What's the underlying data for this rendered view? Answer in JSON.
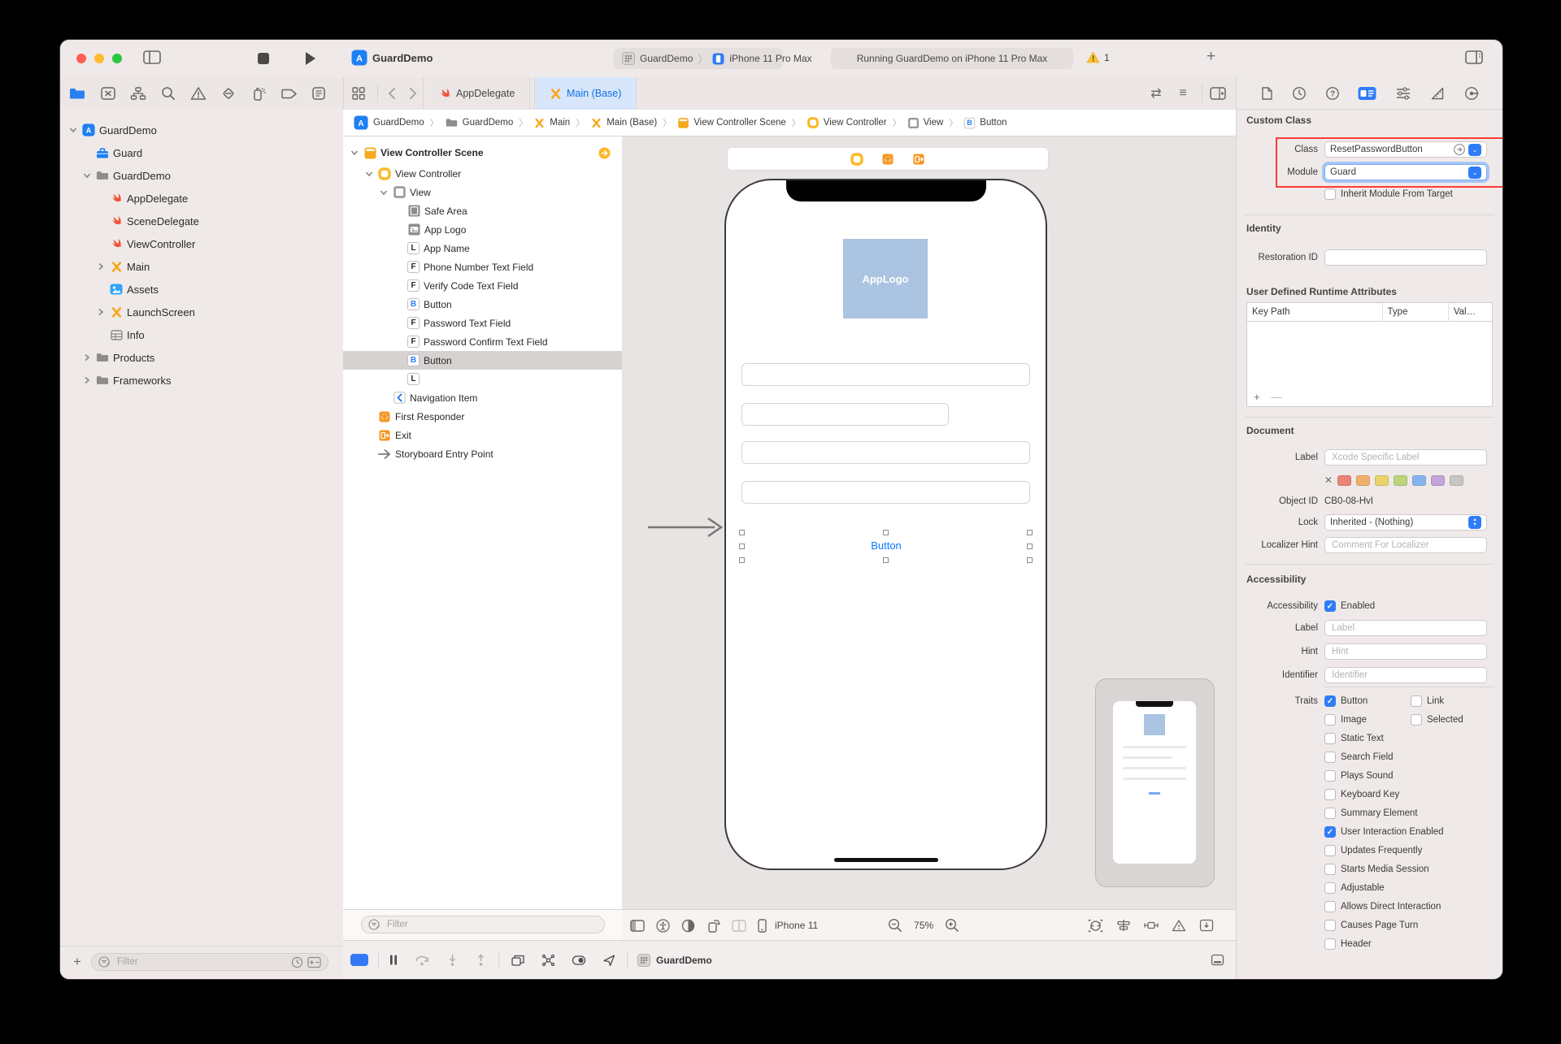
{
  "titlebar": {
    "title": "GuardDemo",
    "scheme": "GuardDemo",
    "run_destination": "iPhone 11 Pro Max",
    "status": "Running GuardDemo on iPhone 11 Pro Max",
    "warning_count": "1"
  },
  "editor": {
    "tabs": [
      {
        "label": "AppDelegate",
        "icon": "swift",
        "active": false
      },
      {
        "label": "Main (Base)",
        "icon": "storyboard",
        "active": true
      }
    ],
    "breadcrumb": [
      {
        "icon": "app",
        "label": "GuardDemo"
      },
      {
        "icon": "folder",
        "label": "GuardDemo"
      },
      {
        "icon": "storyboard",
        "label": "Main"
      },
      {
        "icon": "storyboard",
        "label": "Main (Base)"
      },
      {
        "icon": "scene",
        "label": "View Controller Scene"
      },
      {
        "icon": "vc",
        "label": "View Controller"
      },
      {
        "icon": "view",
        "label": "View"
      },
      {
        "icon": "B",
        "label": "Button"
      }
    ]
  },
  "navigator": {
    "filter_placeholder": "Filter",
    "items": [
      {
        "depth": 0,
        "icon": "app",
        "label": "GuardDemo",
        "disclosure": "open"
      },
      {
        "depth": 1,
        "icon": "toolbox",
        "label": "Guard",
        "disclosure": "none"
      },
      {
        "depth": 1,
        "icon": "folder",
        "label": "GuardDemo",
        "disclosure": "open"
      },
      {
        "depth": 2,
        "icon": "swift",
        "label": "AppDelegate",
        "disclosure": "none"
      },
      {
        "depth": 2,
        "icon": "swift",
        "label": "SceneDelegate",
        "disclosure": "none"
      },
      {
        "depth": 2,
        "icon": "swift",
        "label": "ViewController",
        "disclosure": "none"
      },
      {
        "depth": 2,
        "icon": "storyboard",
        "label": "Main",
        "disclosure": "closed"
      },
      {
        "depth": 2,
        "icon": "assets",
        "label": "Assets",
        "disclosure": "none"
      },
      {
        "depth": 2,
        "icon": "storyboard",
        "label": "LaunchScreen",
        "disclosure": "closed"
      },
      {
        "depth": 2,
        "icon": "info",
        "label": "Info",
        "disclosure": "none"
      },
      {
        "depth": 1,
        "icon": "folder",
        "label": "Products",
        "disclosure": "closed"
      },
      {
        "depth": 1,
        "icon": "folder",
        "label": "Frameworks",
        "disclosure": "closed"
      }
    ]
  },
  "outline": {
    "filter_placeholder": "Filter",
    "items": [
      {
        "depth": 0,
        "icon": "scene",
        "label": "View Controller Scene",
        "disclosure": "open",
        "trailing": "goto",
        "header": true
      },
      {
        "depth": 1,
        "icon": "vc",
        "label": "View Controller",
        "disclosure": "open"
      },
      {
        "depth": 2,
        "icon": "view",
        "label": "View",
        "disclosure": "open"
      },
      {
        "depth": 3,
        "icon": "safearea",
        "label": "Safe Area",
        "disclosure": "none"
      },
      {
        "depth": 3,
        "icon": "image",
        "label": "App Logo",
        "disclosure": "none"
      },
      {
        "depth": 3,
        "icon": "L",
        "label": "App Name",
        "disclosure": "none"
      },
      {
        "depth": 3,
        "icon": "F",
        "label": "Phone Number Text Field",
        "disclosure": "none"
      },
      {
        "depth": 3,
        "icon": "F",
        "label": "Verify Code Text Field",
        "disclosure": "none"
      },
      {
        "depth": 3,
        "icon": "B",
        "label": "Button",
        "disclosure": "none"
      },
      {
        "depth": 3,
        "icon": "F",
        "label": "Password Text Field",
        "disclosure": "none"
      },
      {
        "depth": 3,
        "icon": "F",
        "label": "Password Confirm Text Field",
        "disclosure": "none"
      },
      {
        "depth": 3,
        "icon": "B",
        "label": "Button",
        "disclosure": "none",
        "selected": true
      },
      {
        "depth": 3,
        "icon": "L",
        "label": "",
        "disclosure": "none"
      },
      {
        "depth": 2,
        "icon": "navitem",
        "label": "Navigation Item",
        "disclosure": "none"
      },
      {
        "depth": 1,
        "icon": "responder",
        "label": "First Responder",
        "disclosure": "none"
      },
      {
        "depth": 1,
        "icon": "exit",
        "label": "Exit",
        "disclosure": "none"
      },
      {
        "depth": 1,
        "icon": "entry",
        "label": "Storyboard Entry Point",
        "disclosure": "none"
      }
    ]
  },
  "canvas": {
    "app_logo_label": "AppLogo",
    "selected_button_label": "Button",
    "device_label": "iPhone 11",
    "zoom_level": "75%"
  },
  "inspector": {
    "custom_class": {
      "title": "Custom Class",
      "class_label": "Class",
      "class_value": "ResetPasswordButton",
      "module_label": "Module",
      "module_value": "Guard",
      "inherit_label": "Inherit Module From Target",
      "inherit_checked": false
    },
    "identity": {
      "title": "Identity",
      "restoration_label": "Restoration ID",
      "restoration_placeholder": ""
    },
    "runtime_attributes": {
      "title": "User Defined Runtime Attributes",
      "columns": [
        "Key Path",
        "Type",
        "Val…"
      ]
    },
    "document": {
      "title": "Document",
      "label_label": "Label",
      "label_placeholder": "Xcode Specific Label",
      "object_id_label": "Object ID",
      "object_id_value": "CB0-08-HvI",
      "lock_label": "Lock",
      "lock_value": "Inherited - (Nothing)",
      "localizer_label": "Localizer Hint",
      "localizer_placeholder": "Comment For Localizer",
      "swatch_colors": [
        "#e98577",
        "#efb169",
        "#ead36b",
        "#bcd57c",
        "#88b4ee",
        "#c5a3db",
        "#c9c5c4"
      ]
    },
    "accessibility": {
      "title": "Accessibility",
      "enabled_label": "Accessibility",
      "enabled_value": "Enabled",
      "enabled_checked": true,
      "label_label": "Label",
      "label_placeholder": "Label",
      "hint_label": "Hint",
      "hint_placeholder": "Hint",
      "identifier_label": "Identifier",
      "identifier_placeholder": "Identifier",
      "traits_label": "Traits",
      "traits_rows": [
        [
          {
            "label": "Button",
            "checked": true
          },
          {
            "label": "Link",
            "checked": false
          }
        ],
        [
          {
            "label": "Image",
            "checked": false
          },
          {
            "label": "Selected",
            "checked": false
          }
        ],
        [
          {
            "label": "Static Text",
            "checked": false
          }
        ],
        [
          {
            "label": "Search Field",
            "checked": false
          }
        ],
        [
          {
            "label": "Plays Sound",
            "checked": false
          }
        ],
        [
          {
            "label": "Keyboard Key",
            "checked": false
          }
        ],
        [
          {
            "label": "Summary Element",
            "checked": false
          }
        ],
        [
          {
            "label": "User Interaction Enabled",
            "checked": true
          }
        ],
        [
          {
            "label": "Updates Frequently",
            "checked": false
          }
        ],
        [
          {
            "label": "Starts Media Session",
            "checked": false
          }
        ],
        [
          {
            "label": "Adjustable",
            "checked": false
          }
        ],
        [
          {
            "label": "Allows Direct Interaction",
            "checked": false
          }
        ],
        [
          {
            "label": "Causes Page Turn",
            "checked": false
          }
        ],
        [
          {
            "label": "Header",
            "checked": false
          }
        ]
      ]
    }
  },
  "debugbar": {
    "app_label": "GuardDemo"
  }
}
